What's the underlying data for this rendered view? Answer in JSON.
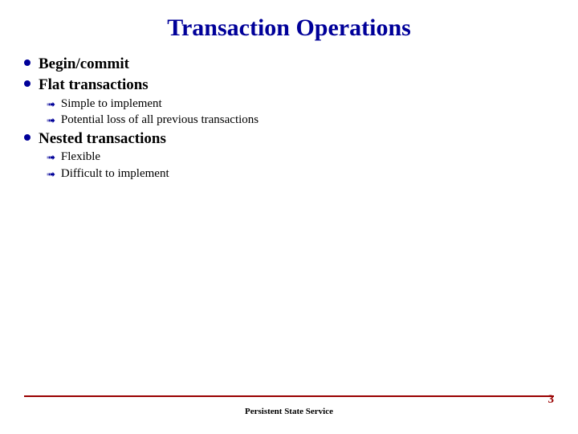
{
  "title": "Transaction Operations",
  "bullets": {
    "b0": "Begin/commit",
    "b1": "Flat transactions",
    "b1_0": "Simple to implement",
    "b1_1": "Potential loss of all previous transactions",
    "b2": "Nested transactions",
    "b2_0": "Flexible",
    "b2_1": "Difficult to implement"
  },
  "footer": "Persistent State Service",
  "page": "3",
  "colors": {
    "accent_blue": "#000099",
    "accent_red": "#990000"
  }
}
